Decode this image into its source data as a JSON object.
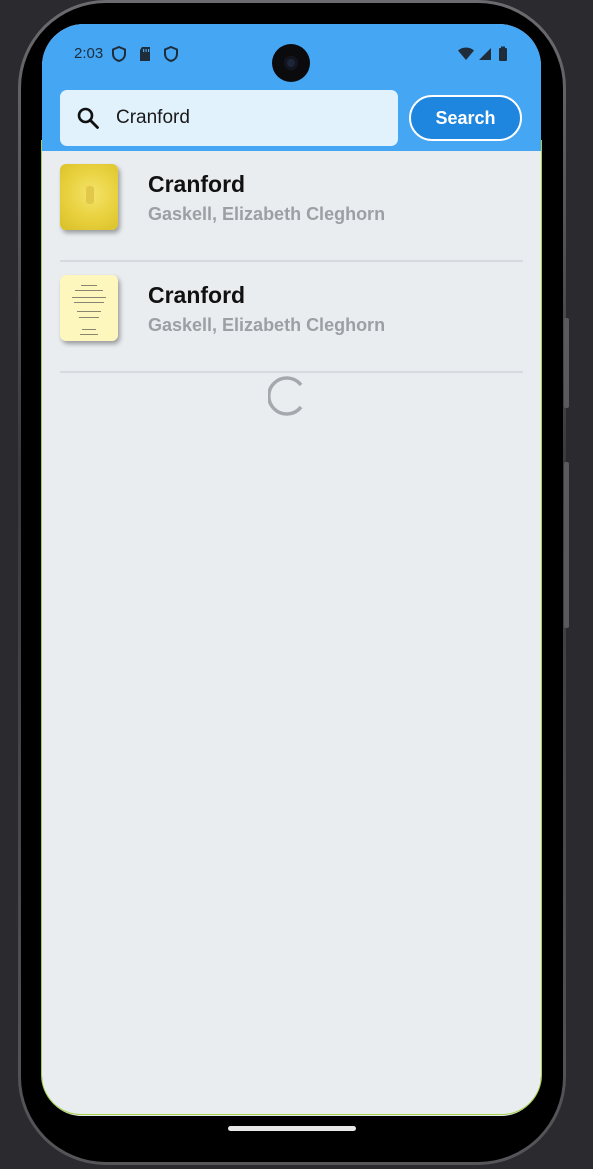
{
  "status_bar": {
    "time": "2:03",
    "left_icons": [
      "shield-icon",
      "sd-card-icon",
      "shield-icon"
    ],
    "right_icons": [
      "wifi-icon",
      "signal-icon",
      "battery-icon"
    ]
  },
  "search": {
    "query": "Cranford",
    "button_label": "Search"
  },
  "results": [
    {
      "title": "Cranford",
      "author": "Gaskell, Elizabeth Cleghorn",
      "cover": "yellow-ornate-cover"
    },
    {
      "title": "Cranford",
      "author": "Gaskell, Elizabeth Cleghorn",
      "cover": "pale-title-page-cover"
    }
  ],
  "loading": true,
  "colors": {
    "app_bar": "#45a6f3",
    "search_button": "#1f86e0",
    "search_field": "#e1f2fd",
    "background": "#eaedf0",
    "author_text": "#9c9fa3"
  }
}
